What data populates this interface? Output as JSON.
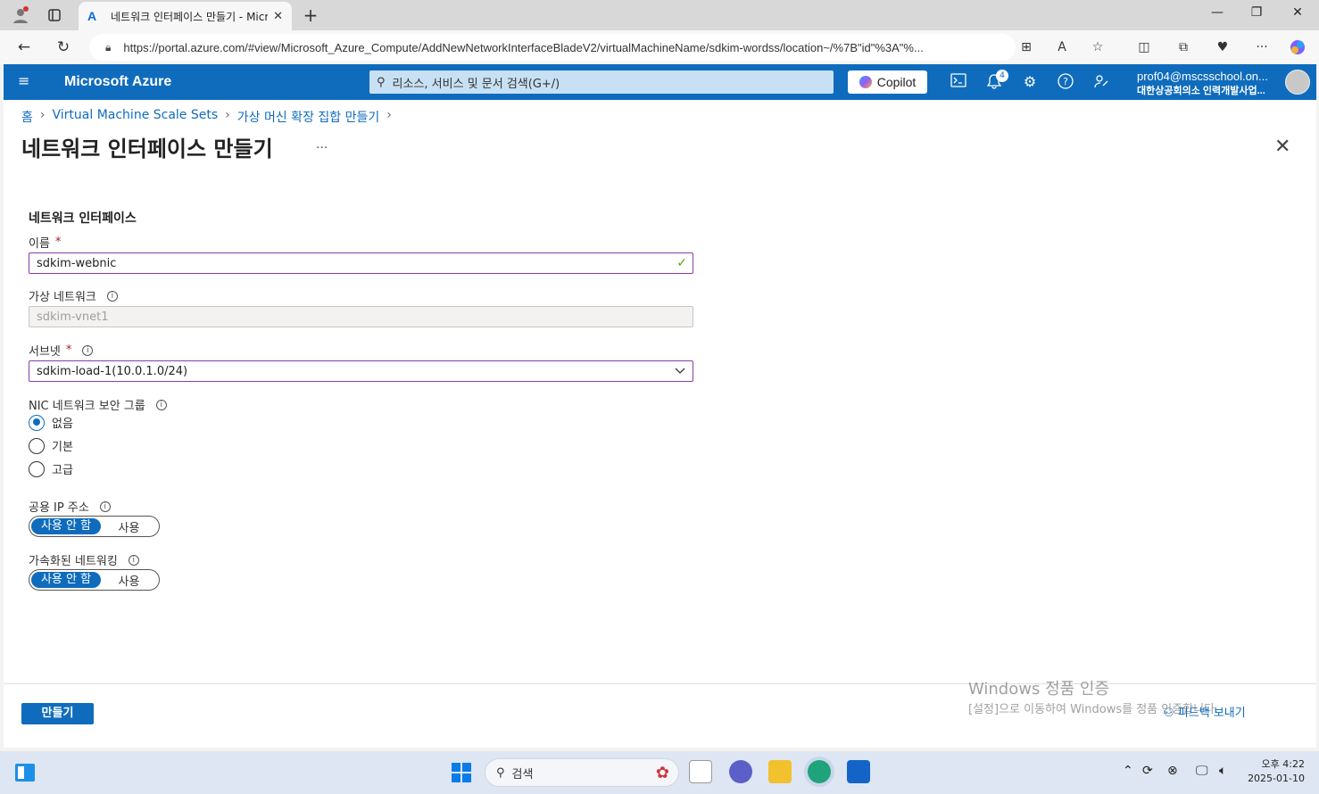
{
  "browser": {
    "tab_title": "네트워크 인터페이스 만들기 - Microsoft Azure",
    "url": "https://portal.azure.com/#view/Microsoft_Azure_Compute/AddNewNetworkInterfaceBladeV2/virtualMachineName/sdkim-wordss/location~/%7B\"id\"%3A\"%..."
  },
  "header": {
    "brand": "Microsoft Azure",
    "search_placeholder": "리소스, 서비스 및 문서 검색(G+/)",
    "copilot_label": "Copilot",
    "notification_count": "4",
    "account_email": "prof04@mscsschool.on...",
    "account_org": "대한상공회의소 인력개발사업..."
  },
  "breadcrumb": [
    "홈",
    "Virtual Machine Scale Sets",
    "가상 머신 확장 집합 만들기"
  ],
  "page": {
    "title": "네트워크 인터페이스 만들기",
    "more": "...",
    "section": "네트워크 인터페이스"
  },
  "form": {
    "name_label": "이름",
    "name_value": "sdkim-webnic",
    "vnet_label": "가상 네트워크",
    "vnet_value": "sdkim-vnet1",
    "subnet_label": "서브넷",
    "subnet_value": "sdkim-load-1(10.0.1.0/24)",
    "nsg_label": "NIC 네트워크 보안 그룹",
    "nsg_options": [
      "없음",
      "기본",
      "고급"
    ],
    "nsg_selected": "없음",
    "public_ip_label": "공용 IP 주소",
    "accel_label": "가속화된 네트워킹",
    "toggle_off": "사용 안 함",
    "toggle_on": "사용",
    "required_mark": "*"
  },
  "footer": {
    "create_label": "만들기",
    "feedback_label": "피드백 보내기"
  },
  "watermark": {
    "line1": "Windows 정품 인증",
    "line2": "[설정]으로 이동하여 Windows를 정품 인증합니다."
  },
  "taskbar": {
    "search_label": "검색",
    "time": "오후 4:22",
    "date": "2025-01-10"
  }
}
